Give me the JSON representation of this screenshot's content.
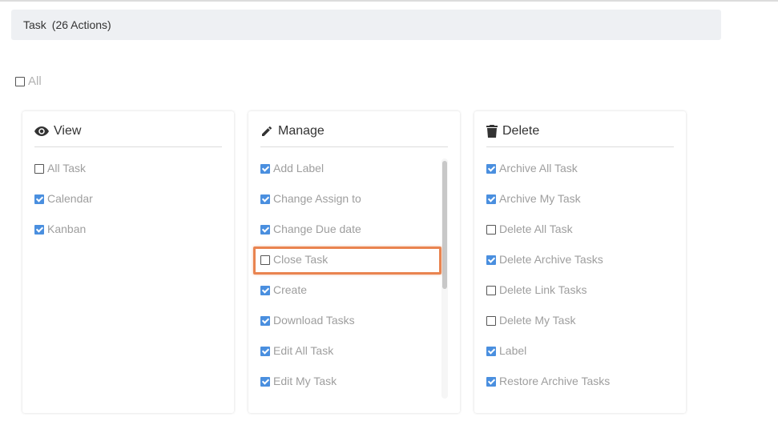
{
  "header": {
    "title": "Task",
    "count": "(26 Actions)"
  },
  "all_toggle": {
    "label": "All",
    "checked": false
  },
  "cards": [
    {
      "icon": "eye-icon",
      "title": "View",
      "items": [
        {
          "label": "All Task",
          "checked": false
        },
        {
          "label": "Calendar",
          "checked": true
        },
        {
          "label": "Kanban",
          "checked": true
        }
      ]
    },
    {
      "icon": "pencil-icon",
      "title": "Manage",
      "items": [
        {
          "label": "Add Label",
          "checked": true
        },
        {
          "label": "Change Assign to",
          "checked": true
        },
        {
          "label": "Change Due date",
          "checked": true
        },
        {
          "label": "Close Task",
          "checked": false
        },
        {
          "label": "Create",
          "checked": true
        },
        {
          "label": "Download Tasks",
          "checked": true
        },
        {
          "label": "Edit All Task",
          "checked": true
        },
        {
          "label": "Edit My Task",
          "checked": true
        }
      ]
    },
    {
      "icon": "trash-icon",
      "title": "Delete",
      "items": [
        {
          "label": "Archive All Task",
          "checked": true
        },
        {
          "label": "Archive My Task",
          "checked": true
        },
        {
          "label": "Delete All Task",
          "checked": false
        },
        {
          "label": "Delete Archive Tasks",
          "checked": true
        },
        {
          "label": "Delete Link Tasks",
          "checked": false
        },
        {
          "label": "Delete My Task",
          "checked": false
        },
        {
          "label": "Label",
          "checked": true
        },
        {
          "label": "Restore Archive Tasks",
          "checked": true
        }
      ]
    }
  ],
  "colors": {
    "accent": "#4a8fdf",
    "highlight": "#e98450",
    "header_bg": "#eef0f3"
  }
}
